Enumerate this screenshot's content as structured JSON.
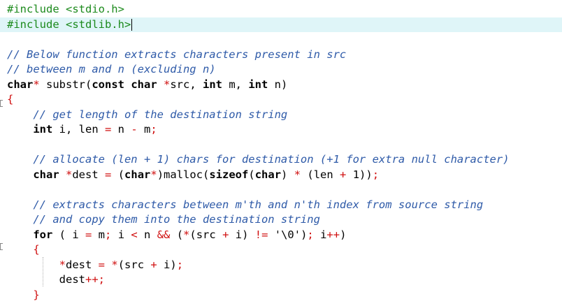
{
  "editor": {
    "language": "C",
    "cursor_line": 2,
    "lines": [
      [
        [
          "pp",
          "#include <stdio.h>"
        ]
      ],
      [
        [
          "pp",
          "#include <stdlib.h>"
        ]
      ],
      [],
      [
        [
          "cm",
          "// Below function extracts characters present in src"
        ]
      ],
      [
        [
          "cm",
          "// between m and n (excluding n)"
        ]
      ],
      [
        [
          "kw",
          "char"
        ],
        [
          "op",
          "*"
        ],
        [
          "txt",
          " substr("
        ],
        [
          "kw",
          "const char"
        ],
        [
          "txt",
          " "
        ],
        [
          "op",
          "*"
        ],
        [
          "txt",
          "src, "
        ],
        [
          "kw",
          "int"
        ],
        [
          "txt",
          " m, "
        ],
        [
          "kw",
          "int"
        ],
        [
          "txt",
          " n)"
        ]
      ],
      [
        [
          "op",
          "{"
        ]
      ],
      [
        [
          "txt",
          "    "
        ],
        [
          "cm",
          "// get length of the destination string"
        ]
      ],
      [
        [
          "txt",
          "    "
        ],
        [
          "kw",
          "int"
        ],
        [
          "txt",
          " i, len "
        ],
        [
          "op",
          "="
        ],
        [
          "txt",
          " n "
        ],
        [
          "op",
          "-"
        ],
        [
          "txt",
          " m"
        ],
        [
          "op",
          ";"
        ]
      ],
      [],
      [
        [
          "txt",
          "    "
        ],
        [
          "cm",
          "// allocate (len + 1) chars for destination (+1 for extra null character)"
        ]
      ],
      [
        [
          "txt",
          "    "
        ],
        [
          "kw",
          "char"
        ],
        [
          "txt",
          " "
        ],
        [
          "op",
          "*"
        ],
        [
          "txt",
          "dest "
        ],
        [
          "op",
          "="
        ],
        [
          "txt",
          " ("
        ],
        [
          "kw",
          "char"
        ],
        [
          "op",
          "*"
        ],
        [
          "txt",
          ")malloc("
        ],
        [
          "kw",
          "sizeof"
        ],
        [
          "txt",
          "("
        ],
        [
          "kw",
          "char"
        ],
        [
          "txt",
          ") "
        ],
        [
          "op",
          "*"
        ],
        [
          "txt",
          " (len "
        ],
        [
          "op",
          "+"
        ],
        [
          "txt",
          " 1))"
        ],
        [
          "op",
          ";"
        ]
      ],
      [],
      [
        [
          "txt",
          "    "
        ],
        [
          "cm",
          "// extracts characters between m'th and n'th index from source string"
        ]
      ],
      [
        [
          "txt",
          "    "
        ],
        [
          "cm",
          "// and copy them into the destination string"
        ]
      ],
      [
        [
          "txt",
          "    "
        ],
        [
          "kw",
          "for"
        ],
        [
          "txt",
          " ( i "
        ],
        [
          "op",
          "="
        ],
        [
          "txt",
          " m"
        ],
        [
          "op",
          ";"
        ],
        [
          "txt",
          " i "
        ],
        [
          "op",
          "<"
        ],
        [
          "txt",
          " n "
        ],
        [
          "op",
          "&&"
        ],
        [
          "txt",
          " ("
        ],
        [
          "op",
          "*"
        ],
        [
          "txt",
          "(src "
        ],
        [
          "op",
          "+"
        ],
        [
          "txt",
          " i) "
        ],
        [
          "op",
          "!="
        ],
        [
          "txt",
          " '\\0')"
        ],
        [
          "op",
          ";"
        ],
        [
          "txt",
          " i"
        ],
        [
          "op",
          "++"
        ],
        [
          "txt",
          ")"
        ]
      ],
      [
        [
          "txt",
          "    "
        ],
        [
          "op",
          "{"
        ]
      ],
      [
        [
          "txt",
          "        "
        ],
        [
          "op",
          "*"
        ],
        [
          "txt",
          "dest "
        ],
        [
          "op",
          "="
        ],
        [
          "txt",
          " "
        ],
        [
          "op",
          "*"
        ],
        [
          "txt",
          "(src "
        ],
        [
          "op",
          "+"
        ],
        [
          "txt",
          " i)"
        ],
        [
          "op",
          ";"
        ]
      ],
      [
        [
          "txt",
          "        dest"
        ],
        [
          "op",
          "++;"
        ]
      ],
      [
        [
          "txt",
          "    "
        ],
        [
          "op",
          "}"
        ]
      ]
    ]
  }
}
